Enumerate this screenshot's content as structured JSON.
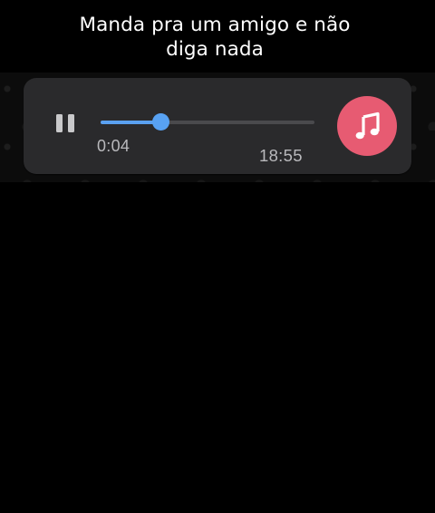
{
  "caption": {
    "line1": "Manda pra um amigo e não",
    "line2": "diga nada"
  },
  "voice_message": {
    "elapsed": "0:04",
    "timestamp": "18:55",
    "progress": 0.28,
    "state": "playing",
    "play_pause_icon": "pause-icon",
    "avatar_icon": "music-note-icon",
    "colors": {
      "bubble": "#2a2a2c",
      "progress_accent": "#58a2f3",
      "avatar_bg": "#e75b72",
      "text": "#b9b9bc"
    }
  }
}
